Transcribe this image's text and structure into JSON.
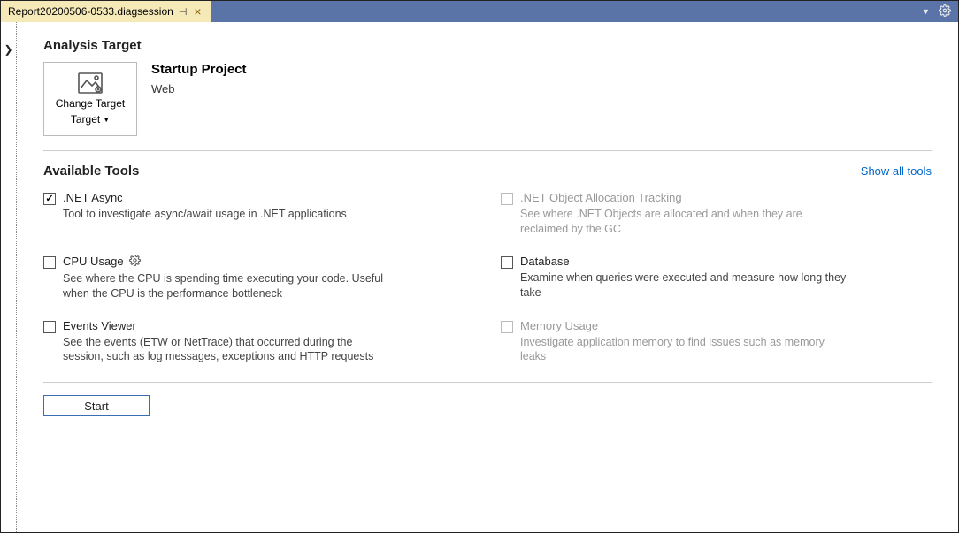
{
  "tab": {
    "title": "Report20200506-0533.diagsession"
  },
  "analysis_target": {
    "heading": "Analysis Target",
    "change_target_label": "Change Target",
    "project_name": "Startup Project",
    "project_type": "Web"
  },
  "tools": {
    "heading": "Available Tools",
    "show_all_label": "Show all tools",
    "items": [
      {
        "title": ".NET Async",
        "desc": "Tool to investigate async/await usage in .NET applications",
        "checked": true,
        "disabled": false,
        "gear": false
      },
      {
        "title": ".NET Object Allocation Tracking",
        "desc": "See where .NET Objects are allocated and when they are reclaimed by the GC",
        "checked": false,
        "disabled": true,
        "gear": false
      },
      {
        "title": "CPU Usage",
        "desc": "See where the CPU is spending time executing your code. Useful when the CPU is the performance bottleneck",
        "checked": false,
        "disabled": false,
        "gear": true
      },
      {
        "title": "Database",
        "desc": "Examine when queries were executed and measure how long they take",
        "checked": false,
        "disabled": false,
        "gear": false
      },
      {
        "title": "Events Viewer",
        "desc": "See the events (ETW or NetTrace) that occurred during the session, such as log messages, exceptions and HTTP requests",
        "checked": false,
        "disabled": false,
        "gear": false
      },
      {
        "title": "Memory Usage",
        "desc": "Investigate application memory to find issues such as memory leaks",
        "checked": false,
        "disabled": true,
        "gear": false
      }
    ]
  },
  "start_label": "Start"
}
